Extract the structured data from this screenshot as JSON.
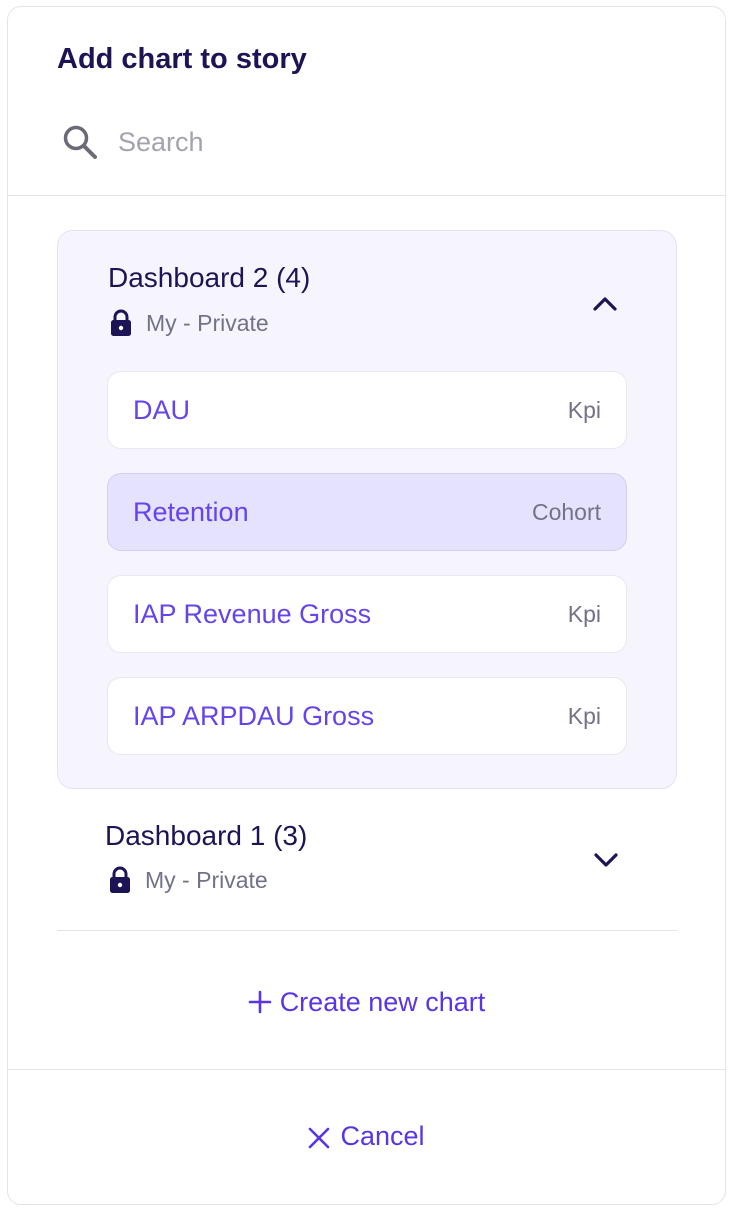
{
  "dialog": {
    "title": "Add chart to story"
  },
  "search": {
    "placeholder": "Search",
    "value": "",
    "icon": "search-icon"
  },
  "dashboards": [
    {
      "title": "Dashboard 2 (4)",
      "visibility": "My - Private",
      "expanded": true,
      "charts": [
        {
          "name": "DAU",
          "type": "Kpi",
          "selected": false
        },
        {
          "name": "Retention",
          "type": "Cohort",
          "selected": true
        },
        {
          "name": "IAP Revenue Gross",
          "type": "Kpi",
          "selected": false
        },
        {
          "name": "IAP ARPDAU Gross",
          "type": "Kpi",
          "selected": false
        }
      ]
    },
    {
      "title": "Dashboard 1 (3)",
      "visibility": "My - Private",
      "expanded": false
    }
  ],
  "actions": {
    "create_label": "Create new chart",
    "cancel_label": "Cancel"
  },
  "colors": {
    "accent": "#6644ea",
    "title": "#1c1454",
    "muted": "#727288",
    "group_bg": "#f6f5fe",
    "selected_bg": "#e5e2fd"
  }
}
